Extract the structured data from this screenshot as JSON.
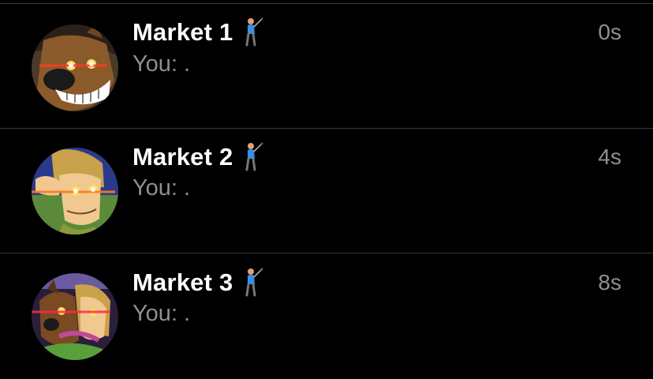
{
  "conversations": [
    {
      "name": "Market 1",
      "emoji_icon": "golfer-icon",
      "preview": "You: .",
      "time": "0s",
      "avatar_icon": "scooby-laser-eyes-avatar"
    },
    {
      "name": "Market 2",
      "emoji_icon": "golfer-icon",
      "preview": "You: .",
      "time": "4s",
      "avatar_icon": "shaggy-laser-eyes-avatar"
    },
    {
      "name": "Market 3",
      "emoji_icon": "golfer-icon",
      "preview": "You: .",
      "time": "8s",
      "avatar_icon": "scooby-shaggy-laser-eyes-avatar"
    }
  ],
  "colors": {
    "background": "#000000",
    "name_text": "#ffffff",
    "secondary_text": "#8e8e93",
    "divider": "#3a3a3c"
  }
}
